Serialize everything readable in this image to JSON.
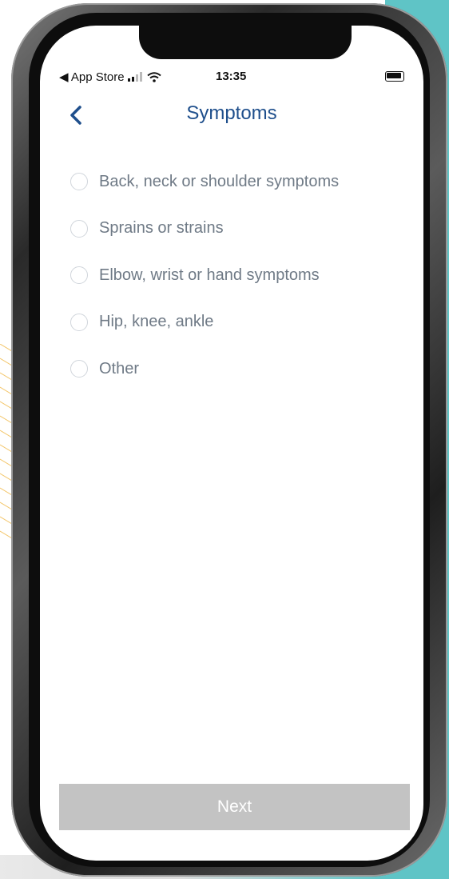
{
  "status_bar": {
    "carrier": "◀ App Store",
    "time": "13:35"
  },
  "nav": {
    "title": "Symptoms",
    "back_icon": "chevron-left-icon"
  },
  "options": [
    {
      "label": "Back, neck or shoulder symptoms",
      "selected": false
    },
    {
      "label": "Sprains or strains",
      "selected": false
    },
    {
      "label": "Elbow, wrist or hand symptoms",
      "selected": false
    },
    {
      "label": "Hip, knee, ankle",
      "selected": false
    },
    {
      "label": "Other",
      "selected": false
    }
  ],
  "footer": {
    "next_label": "Next"
  },
  "colors": {
    "accent": "#1f4f8c",
    "option_text": "#6f7a86",
    "button_disabled": "#c3c3c3",
    "backdrop_teal": "#5fc4c6",
    "deco_yellow": "#f3c66b"
  }
}
